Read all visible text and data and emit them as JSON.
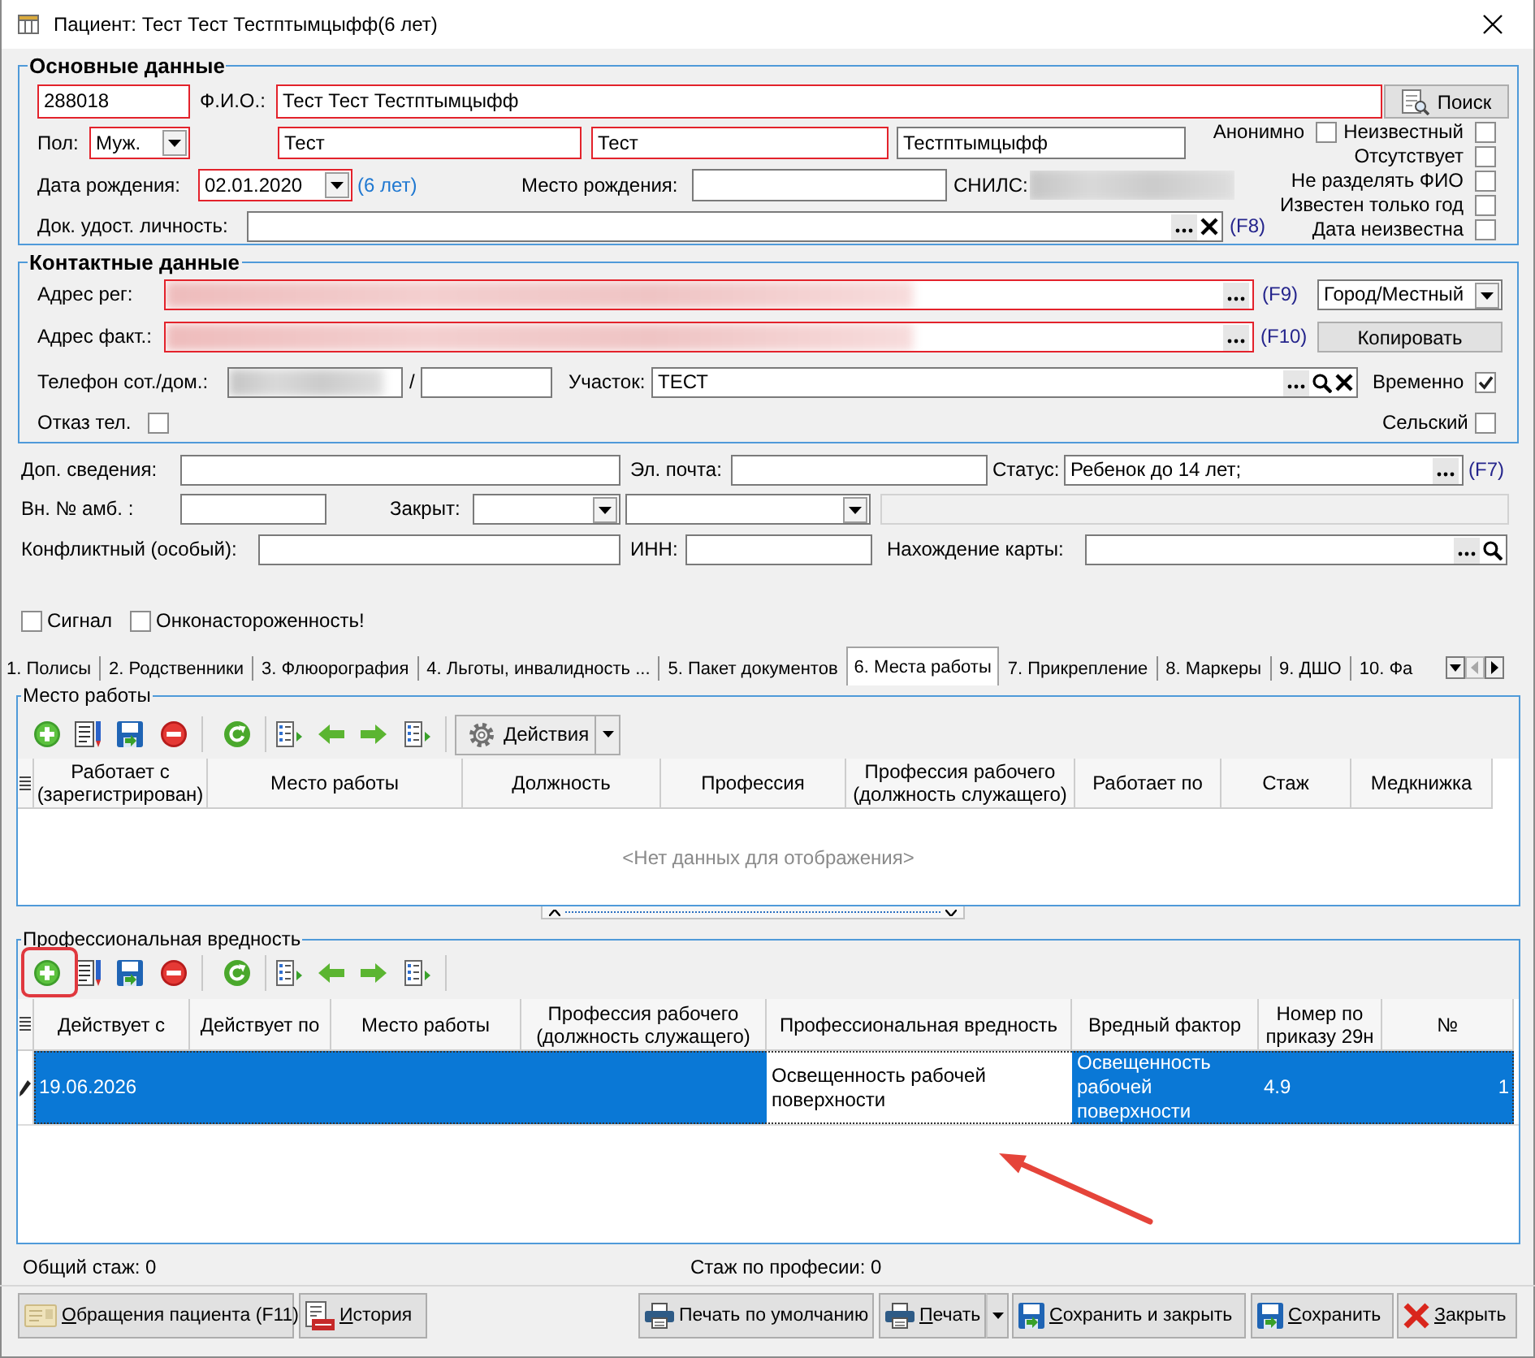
{
  "window": {
    "title": "Пациент: Тест Тест Тестптымцыфф(6 лет)"
  },
  "main_data": {
    "title": "Основные данные",
    "lines": [
      {
        "items": [
          {
            "kind": "field",
            "value": "288018",
            "required": true,
            "disabled": false
          },
          {
            "kind": "label",
            "text": "Ф.И.О.:"
          },
          {
            "kind": "field",
            "value": "Тест Тест Тестптымцыфф",
            "required": true,
            "disabled": false
          },
          {
            "kind": "button",
            "label": "Поиск"
          }
        ]
      },
      {
        "items": [
          {
            "kind": "label",
            "text": "Пол:"
          },
          {
            "kind": "select",
            "value": "Муж.",
            "required": true,
            "disabled": false
          },
          {
            "kind": "field",
            "value": "Тест",
            "required": true,
            "disabled": false
          },
          {
            "kind": "field",
            "value": "Тест",
            "required": true,
            "disabled": false
          },
          {
            "kind": "field",
            "value": "Тестптымцыфф",
            "required": false,
            "disabled": false
          }
        ]
      },
      {
        "items": [
          {
            "kind": "label",
            "text": "Дата рождения:"
          },
          {
            "kind": "select",
            "value": "02.01.2020",
            "required": true,
            "disabled": false
          },
          {
            "kind": "note",
            "text": "(6 лет)"
          },
          {
            "kind": "label",
            "text": "Место рождения:"
          },
          {
            "kind": "field",
            "required": false,
            "disabled": false
          },
          {
            "kind": "label",
            "text": "СНИЛС:"
          },
          {
            "kind": "blurred-field",
            "required": false
          }
        ]
      },
      {
        "items": [
          {
            "kind": "label",
            "text": "Док. удост. личность:"
          },
          {
            "kind": "field",
            "required": false,
            "disabled": false,
            "buttons": [
              {
                "kind": "more"
              },
              {
                "kind": "clear"
              }
            ]
          },
          {
            "kind": "hotkey",
            "text": "(F8)"
          }
        ]
      }
    ],
    "flags": [
      {
        "label": "Анонимно",
        "checked": false
      },
      {
        "label": "Неизвестный",
        "checked": false
      },
      {
        "label": "Отсутствует",
        "checked": false
      },
      {
        "label": "Не разделять ФИО",
        "checked": false
      },
      {
        "label": "Известен только год",
        "checked": false
      },
      {
        "label": "Дата неизвестна",
        "checked": false
      }
    ]
  },
  "contacts": {
    "title": "Контактные данные",
    "lines": [
      {
        "items": [
          {
            "kind": "label",
            "text": "Адрес рег:"
          },
          {
            "kind": "blurred-field",
            "required": true,
            "disabled": false,
            "buttons": [
              {
                "kind": "more"
              }
            ]
          },
          {
            "kind": "hotkey",
            "text": "(F9)"
          },
          {
            "kind": "select",
            "value": "Город/Местный",
            "required": false,
            "disabled": false
          }
        ]
      },
      {
        "items": [
          {
            "kind": "label",
            "text": "Адрес факт.:"
          },
          {
            "kind": "blurred-field",
            "required": true,
            "disabled": false,
            "buttons": [
              {
                "kind": "more"
              }
            ]
          },
          {
            "kind": "hotkey",
            "text": "(F10)"
          },
          {
            "kind": "button",
            "label": "Копировать"
          }
        ]
      },
      {
        "items": [
          {
            "kind": "label",
            "text": "Телефон сот./дом.:"
          },
          {
            "kind": "blurred-field",
            "required": false,
            "disabled": false
          },
          {
            "kind": "label",
            "text": "/"
          },
          {
            "kind": "field",
            "required": false,
            "disabled": false
          },
          {
            "kind": "label",
            "text": "Участок:"
          },
          {
            "kind": "field",
            "value": "ТЕСТ",
            "required": false,
            "disabled": false,
            "buttons": [
              {
                "kind": "more"
              },
              {
                "kind": "search"
              },
              {
                "kind": "clear"
              }
            ]
          },
          {
            "kind": "check",
            "label": "Временно",
            "checked": true
          }
        ]
      },
      {
        "items": [
          {
            "kind": "check",
            "label": "Отказ тел.",
            "checked": false
          },
          {
            "kind": "check",
            "label": "Сельский",
            "checked": false
          }
        ]
      }
    ]
  },
  "extra": {
    "lines": [
      {
        "items": [
          {
            "kind": "label",
            "text": "Доп. сведения:"
          },
          {
            "kind": "field",
            "required": false,
            "disabled": false
          },
          {
            "kind": "label",
            "text": "Эл. почта:"
          },
          {
            "kind": "field",
            "required": false,
            "disabled": false
          },
          {
            "kind": "label",
            "text": "Статус:"
          },
          {
            "kind": "field",
            "value": "Ребенок до 14 лет;",
            "required": false,
            "disabled": false,
            "buttons": [
              {
                "kind": "more"
              }
            ]
          },
          {
            "kind": "hotkey",
            "text": "(F7)"
          }
        ]
      },
      {
        "items": [
          {
            "kind": "label",
            "text": "Вн. № амб. :"
          },
          {
            "kind": "field",
            "required": false,
            "disabled": false
          },
          {
            "kind": "label",
            "text": "Закрыт:"
          },
          {
            "kind": "select",
            "required": false,
            "disabled": false
          },
          {
            "kind": "select",
            "required": false,
            "disabled": false
          },
          {
            "kind": "field",
            "required": false,
            "disabled": true
          }
        ]
      },
      {
        "items": [
          {
            "kind": "label",
            "text": "Конфликтный (особый):"
          },
          {
            "kind": "field",
            "required": false,
            "disabled": false
          },
          {
            "kind": "label",
            "text": "ИНН:"
          },
          {
            "kind": "field",
            "required": false,
            "disabled": false
          },
          {
            "kind": "label",
            "text": "Нахождение карты:"
          },
          {
            "kind": "field",
            "required": false,
            "disabled": false,
            "buttons": [
              {
                "kind": "more"
              },
              {
                "kind": "search"
              }
            ]
          }
        ]
      }
    ],
    "flags": [
      {
        "label": "Сигнал",
        "checked": false
      },
      {
        "label": "Онконастороженность!",
        "checked": false
      }
    ]
  },
  "tabs": [
    {
      "label": "1. Полисы",
      "selected": false
    },
    {
      "label": "2. Родственники",
      "selected": false
    },
    {
      "label": "3. Флюорография",
      "selected": false
    },
    {
      "label": "4. Льготы, инвалидность ...",
      "selected": false
    },
    {
      "label": "5. Пакет документов",
      "selected": false
    },
    {
      "label": "6. Места работы",
      "selected": true
    },
    {
      "label": "7. Прикрепление",
      "selected": false
    },
    {
      "label": "8. Маркеры",
      "selected": false
    },
    {
      "label": "9. ДШО",
      "selected": false
    },
    {
      "label": "10. Фа",
      "selected": false
    }
  ],
  "workplaces": {
    "title": "Место работы",
    "toolbar": [
      {
        "kind": "add"
      },
      {
        "kind": "edit"
      },
      {
        "kind": "save"
      },
      {
        "kind": "delete"
      },
      {
        "kind": "separator"
      },
      {
        "kind": "refresh"
      },
      {
        "kind": "separator"
      },
      {
        "kind": "import"
      },
      {
        "kind": "back"
      },
      {
        "kind": "forward"
      },
      {
        "kind": "export"
      },
      {
        "kind": "separator"
      },
      {
        "kind": "menu",
        "label": "Действия"
      }
    ],
    "columns": [
      "Работает с (зарегистрирован)",
      "Место работы",
      "Должность",
      "Профессия",
      "Профессия рабочего (должность служащего)",
      "Работает по",
      "Стаж",
      "Медкнижка"
    ],
    "empty_text": "<Нет данных для отображения>"
  },
  "hazards": {
    "title": "Профессиональная вредность",
    "toolbar": [
      {
        "kind": "add"
      },
      {
        "kind": "edit"
      },
      {
        "kind": "save"
      },
      {
        "kind": "delete"
      },
      {
        "kind": "separator"
      },
      {
        "kind": "refresh"
      },
      {
        "kind": "separator"
      },
      {
        "kind": "import"
      },
      {
        "kind": "back"
      },
      {
        "kind": "forward"
      },
      {
        "kind": "export"
      },
      {
        "kind": "separator"
      }
    ],
    "columns": [
      "Действует с",
      "Действует по",
      "Место работы",
      "Профессия рабочего (должность служащего)",
      "Профессиональная вредность",
      "Вредный фактор",
      "Номер по приказу 29н",
      "№"
    ],
    "rows": [
      {
        "selected": true,
        "cells": [
          {
            "text": "19.06.2026",
            "focused": false
          },
          {
            "focused": false
          },
          {
            "focused": false
          },
          {
            "focused": false
          },
          {
            "text": "Освещенность рабочей поверхности",
            "focused": true
          },
          {
            "text": "Освещенность рабочей поверхности",
            "focused": false
          },
          {
            "text": "4.9",
            "focused": false
          },
          {
            "text": "1",
            "focused": false
          }
        ]
      }
    ],
    "annotations": [
      {
        "kind": "frame"
      },
      {
        "kind": "arrow"
      }
    ]
  },
  "status": {
    "total_experience": "Общий стаж: 0",
    "profession_experience": "Стаж по професии: 0"
  },
  "buttons": [
    {
      "kind": "appeals",
      "label": "Обращения пациента (F11)",
      "mnemonic": true
    },
    {
      "kind": "history",
      "label": "История",
      "mnemonic": true
    },
    {
      "kind": "print",
      "label": "Печать по умолчанию",
      "mnemonic": false
    },
    {
      "kind": "print-menu",
      "label": "Печать",
      "mnemonic": true
    },
    {
      "kind": "save-close",
      "label": "Сохранить и закрыть",
      "mnemonic": true
    },
    {
      "kind": "save",
      "label": "Сохранить",
      "mnemonic": true
    },
    {
      "kind": "close",
      "label": "Закрыть",
      "mnemonic": true
    }
  ]
}
